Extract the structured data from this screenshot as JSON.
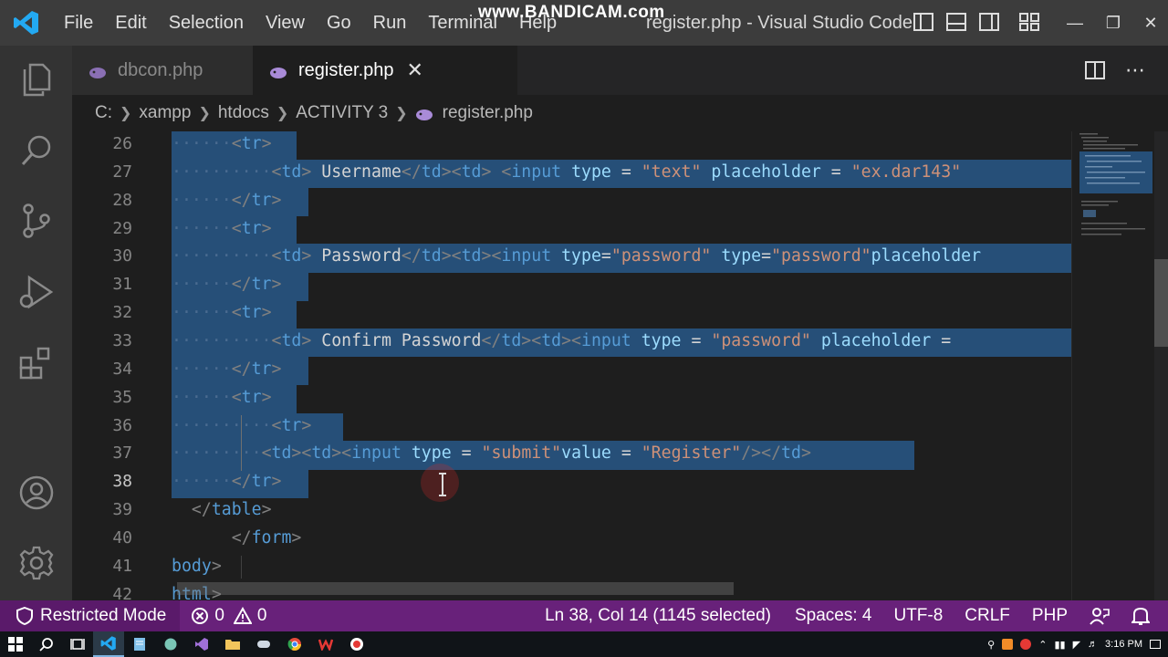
{
  "window": {
    "title": "register.php - Visual Studio Code",
    "watermark": "www.BANDICAM.com",
    "menu": [
      "File",
      "Edit",
      "Selection",
      "View",
      "Go",
      "Run",
      "Terminal",
      "Help"
    ]
  },
  "tabs": [
    {
      "label": "dbcon.php",
      "active": false
    },
    {
      "label": "register.php",
      "active": true
    }
  ],
  "breadcrumb": [
    "C:",
    "xampp",
    "htdocs",
    "ACTIVITY 3",
    "register.php"
  ],
  "editor": {
    "active_line": 38,
    "lines": [
      {
        "n": "26",
        "dots": "······",
        "tokens": [
          [
            "tg",
            "<"
          ],
          [
            "tn",
            "tr"
          ],
          [
            "tg",
            ">"
          ]
        ]
      },
      {
        "n": "27",
        "dots": "··········",
        "tokens": [
          [
            "tg",
            "<"
          ],
          [
            "tn",
            "td"
          ],
          [
            "tg",
            ">"
          ],
          [
            "tx",
            " Username"
          ],
          [
            "tg",
            "</"
          ],
          [
            "tn",
            "td"
          ],
          [
            "tg",
            "><"
          ],
          [
            "tn",
            "td"
          ],
          [
            "tg",
            ">"
          ],
          [
            "tx",
            " "
          ],
          [
            "tg",
            "<"
          ],
          [
            "tn",
            "input"
          ],
          [
            "tx",
            " "
          ],
          [
            "at",
            "type"
          ],
          [
            "tx",
            " = "
          ],
          [
            "st",
            "\"text\""
          ],
          [
            "tx",
            " "
          ],
          [
            "at",
            "placeholder"
          ],
          [
            "tx",
            " = "
          ],
          [
            "st",
            "\"ex.dar143\""
          ]
        ]
      },
      {
        "n": "28",
        "dots": "······",
        "tokens": [
          [
            "tg",
            "</"
          ],
          [
            "tn",
            "tr"
          ],
          [
            "tg",
            ">"
          ]
        ]
      },
      {
        "n": "29",
        "dots": "······",
        "tokens": [
          [
            "tg",
            "<"
          ],
          [
            "tn",
            "tr"
          ],
          [
            "tg",
            ">"
          ]
        ]
      },
      {
        "n": "30",
        "dots": "··········",
        "tokens": [
          [
            "tg",
            "<"
          ],
          [
            "tn",
            "td"
          ],
          [
            "tg",
            ">"
          ],
          [
            "tx",
            " Password"
          ],
          [
            "tg",
            "</"
          ],
          [
            "tn",
            "td"
          ],
          [
            "tg",
            "><"
          ],
          [
            "tn",
            "td"
          ],
          [
            "tg",
            "><"
          ],
          [
            "tn",
            "input"
          ],
          [
            "tx",
            " "
          ],
          [
            "at",
            "type"
          ],
          [
            "tx",
            "="
          ],
          [
            "st",
            "\"password\""
          ],
          [
            "tx",
            " "
          ],
          [
            "at",
            "type"
          ],
          [
            "tx",
            "="
          ],
          [
            "st",
            "\"password\""
          ],
          [
            "at",
            "placeholder"
          ]
        ]
      },
      {
        "n": "31",
        "dots": "······",
        "tokens": [
          [
            "tg",
            "</"
          ],
          [
            "tn",
            "tr"
          ],
          [
            "tg",
            ">"
          ]
        ]
      },
      {
        "n": "32",
        "dots": "······",
        "tokens": [
          [
            "tg",
            "<"
          ],
          [
            "tn",
            "tr"
          ],
          [
            "tg",
            ">"
          ]
        ]
      },
      {
        "n": "33",
        "dots": "··········",
        "tokens": [
          [
            "tg",
            "<"
          ],
          [
            "tn",
            "td"
          ],
          [
            "tg",
            ">"
          ],
          [
            "tx",
            " Confirm Password"
          ],
          [
            "tg",
            "</"
          ],
          [
            "tn",
            "td"
          ],
          [
            "tg",
            "><"
          ],
          [
            "tn",
            "td"
          ],
          [
            "tg",
            "><"
          ],
          [
            "tn",
            "input"
          ],
          [
            "tx",
            " "
          ],
          [
            "at",
            "type"
          ],
          [
            "tx",
            " = "
          ],
          [
            "st",
            "\"password\""
          ],
          [
            "tx",
            " "
          ],
          [
            "at",
            "placeholder"
          ],
          [
            "tx",
            " ="
          ]
        ]
      },
      {
        "n": "34",
        "dots": "······",
        "tokens": [
          [
            "tg",
            "</"
          ],
          [
            "tn",
            "tr"
          ],
          [
            "tg",
            ">"
          ]
        ]
      },
      {
        "n": "35",
        "dots": "······",
        "tokens": [
          [
            "tg",
            "<"
          ],
          [
            "tn",
            "tr"
          ],
          [
            "tg",
            ">"
          ]
        ]
      },
      {
        "n": "36",
        "dots": "··········",
        "tokens": [
          [
            "tg",
            "<"
          ],
          [
            "tn",
            "tr"
          ],
          [
            "tg",
            ">"
          ]
        ]
      },
      {
        "n": "37",
        "dots": "·········",
        "tokens": [
          [
            "tg",
            "<"
          ],
          [
            "tn",
            "td"
          ],
          [
            "tg",
            "><"
          ],
          [
            "tn",
            "td"
          ],
          [
            "tg",
            "><"
          ],
          [
            "tn",
            "input"
          ],
          [
            "tx",
            " "
          ],
          [
            "at",
            "type"
          ],
          [
            "tx",
            " = "
          ],
          [
            "st",
            "\"submit\""
          ],
          [
            "at",
            "value"
          ],
          [
            "tx",
            " = "
          ],
          [
            "st",
            "\"Register\""
          ],
          [
            "tg",
            "/></"
          ],
          [
            "tn",
            "td"
          ],
          [
            "tg",
            ">"
          ]
        ]
      },
      {
        "n": "38",
        "dots": "······",
        "tokens": [
          [
            "tg",
            "</"
          ],
          [
            "tn",
            "tr"
          ],
          [
            "tg",
            ">"
          ]
        ]
      },
      {
        "n": "39",
        "dots": "  ",
        "tokens": [
          [
            "tg",
            "</"
          ],
          [
            "tn",
            "table"
          ],
          [
            "tg",
            ">"
          ]
        ]
      },
      {
        "n": "40",
        "dots": "      ",
        "tokens": [
          [
            "tg",
            "</"
          ],
          [
            "tn",
            "form"
          ],
          [
            "tg",
            ">"
          ]
        ]
      },
      {
        "n": "41",
        "dots": "",
        "tokens": [
          [
            "tn",
            "body"
          ],
          [
            "tg",
            ">"
          ]
        ]
      },
      {
        "n": "42",
        "dots": "",
        "tokens": [
          [
            "tn",
            "html"
          ],
          [
            "tg",
            ">"
          ]
        ]
      }
    ]
  },
  "statusbar": {
    "restricted": "Restricted Mode",
    "errors": "0",
    "warnings": "0",
    "position": "Ln 38, Col 14 (1145 selected)",
    "spaces": "Spaces: 4",
    "encoding": "UTF-8",
    "eol": "CRLF",
    "language": "PHP"
  },
  "taskbar": {
    "time": "3:16 PM"
  },
  "colors": {
    "accent": "#68217a",
    "selection": "#264f78",
    "editor_bg": "#1e1e1e"
  }
}
